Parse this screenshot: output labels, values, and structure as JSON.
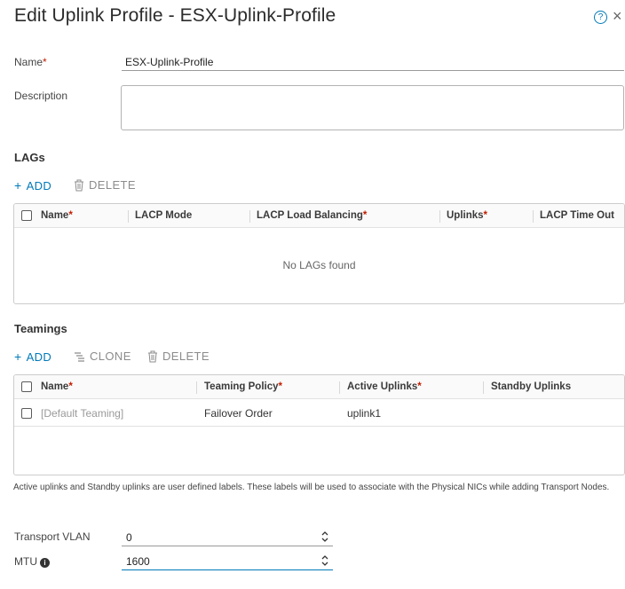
{
  "dialog": {
    "title": "Edit Uplink Profile - ESX-Uplink-Profile",
    "help_glyph": "?",
    "close_glyph": "×"
  },
  "form": {
    "name_label": "Name",
    "name_value": "ESX-Uplink-Profile",
    "description_label": "Description",
    "description_value": "",
    "required_mark": "*"
  },
  "lags": {
    "title": "LAGs",
    "add_label": "ADD",
    "delete_label": "DELETE",
    "columns": [
      "Name",
      "LACP Mode",
      "LACP Load Balancing",
      "Uplinks",
      "LACP Time Out"
    ],
    "required_columns": [
      true,
      false,
      true,
      true,
      false
    ],
    "empty_message": "No LAGs found"
  },
  "teamings": {
    "title": "Teamings",
    "add_label": "ADD",
    "clone_label": "CLONE",
    "delete_label": "DELETE",
    "columns": [
      "Name",
      "Teaming Policy",
      "Active Uplinks",
      "Standby Uplinks"
    ],
    "required_columns": [
      true,
      true,
      true,
      false
    ],
    "rows": [
      {
        "name": "[Default Teaming]",
        "policy": "Failover Order",
        "active": "uplink1",
        "standby": ""
      }
    ]
  },
  "note": "Active uplinks and Standby uplinks are user defined labels. These labels will be used to associate with the Physical NICs while adding Transport Nodes.",
  "transport_vlan": {
    "label": "Transport VLAN",
    "value": "0"
  },
  "mtu": {
    "label": "MTU",
    "value": "1600",
    "info_glyph": "i"
  },
  "colors": {
    "accent": "#0079b8",
    "required": "#c21d00",
    "disabled": "#8c8c8c"
  }
}
